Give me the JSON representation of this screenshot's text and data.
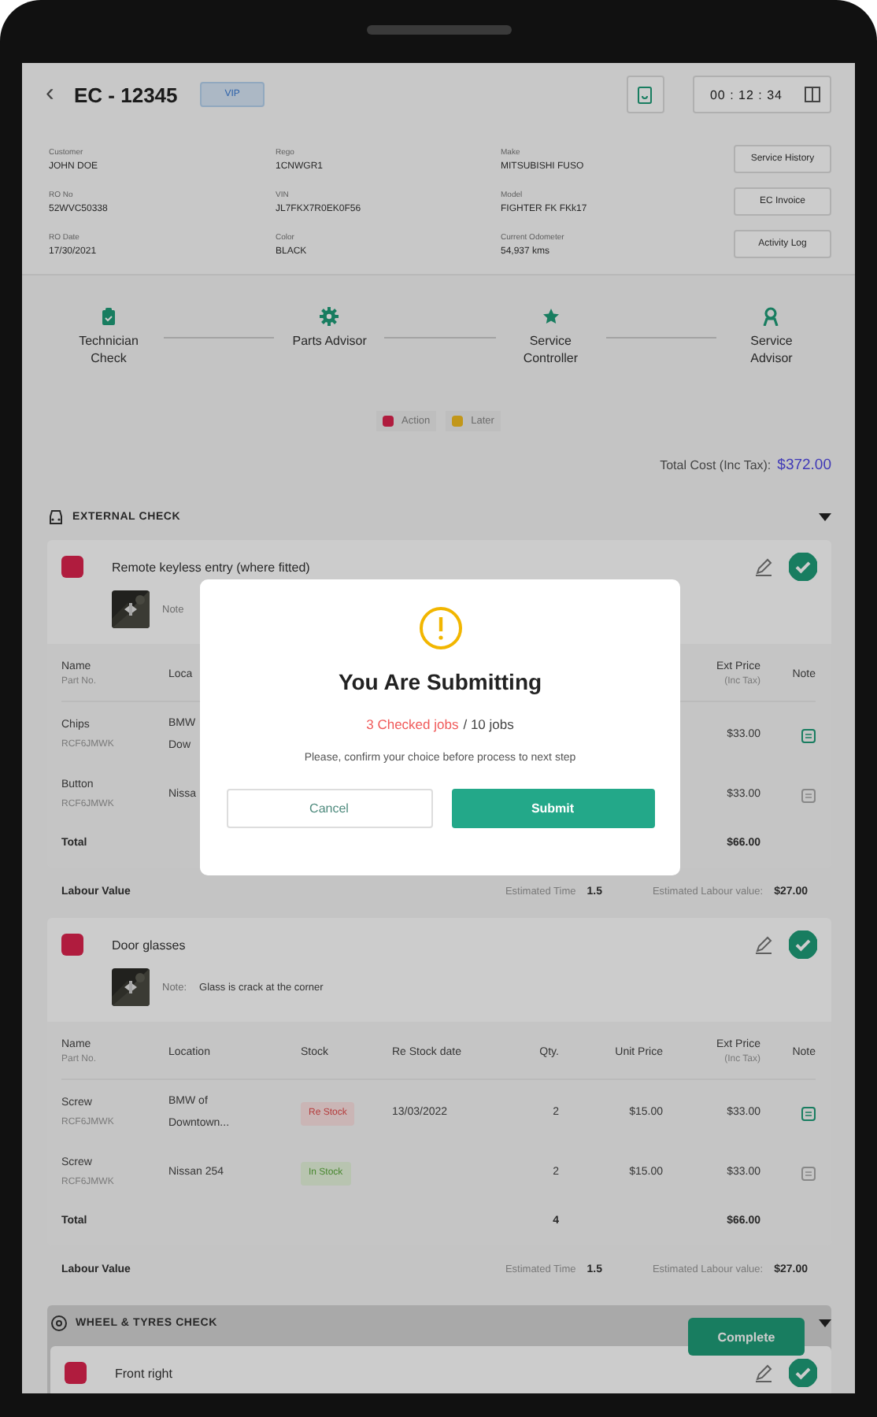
{
  "header": {
    "back": "‹",
    "title": "EC - 12345",
    "badge": "VIP",
    "timer": "00 : 12 : 34"
  },
  "info": [
    {
      "label": "Customer",
      "value": "JOHN DOE"
    },
    {
      "label": "Rego",
      "value": "1CNWGR1"
    },
    {
      "label": "Make",
      "value": "MITSUBISHI FUSO"
    },
    {
      "label": "RO No",
      "value": "52WVC50338"
    },
    {
      "label": "VIN",
      "value": "JL7FKX7R0EK0F56"
    },
    {
      "label": "Model",
      "value": "FIGHTER FK FKk17"
    },
    {
      "label": "RO Date",
      "value": "17/30/2021"
    },
    {
      "label": "Color",
      "value": "BLACK"
    },
    {
      "label": "Current Odometer",
      "value": "54,937 kms"
    }
  ],
  "info_buttons": [
    "Service History",
    "EC Invoice",
    "Activity Log"
  ],
  "steps": [
    {
      "label": "Technician Check"
    },
    {
      "label": "Parts Advisor"
    },
    {
      "label": "Service Controller"
    },
    {
      "label": "Service Advisor"
    }
  ],
  "legend": [
    {
      "label": "Action",
      "color": "#b01c3e"
    },
    {
      "label": "Later",
      "color": "#c2971a"
    }
  ],
  "total": {
    "label": "Total Cost (Inc Tax):",
    "value": "$372.00"
  },
  "sections": [
    {
      "title": "EXTERNAL CHECK",
      "items": [
        {
          "title": "Remote keyless entry (where fitted)",
          "color": "#b01c3e",
          "checked": true,
          "photo": {
            "kind": "picture"
          },
          "note_label": "Note",
          "columns": {
            "name": {
              "label": "Name",
              "sub": "Part No."
            },
            "location": {
              "label": "Loca"
            },
            "ext": {
              "label": "Ext Price",
              "sub": "(Inc Tax)"
            },
            "note": {
              "label": "Note"
            }
          },
          "rows": [
            {
              "name": "Chips",
              "part": "RCF6JMWK",
              "location": [
                "BMW",
                "Dow"
              ],
              "ext": "$33.00",
              "note_on": true
            },
            {
              "name": "Button",
              "part": "RCF6JMWK",
              "location": [
                "Nissa"
              ],
              "ext": "$33.00",
              "note_on": false
            }
          ],
          "total": {
            "label": "Total",
            "ext": "$66.00"
          },
          "labour": {
            "label": "Labour Value",
            "time_label": "Estimated Time",
            "time": "1.5",
            "value_label": "Estimated Labour value:",
            "value": "$27.00"
          }
        },
        {
          "title": "Door glasses",
          "color": "#b01c3e",
          "checked": true,
          "photo": {
            "kind": "picture"
          },
          "note_label": "Note:",
          "note": "Glass is crack at the corner",
          "columns": {
            "name": {
              "label": "Name",
              "sub": "Part No."
            },
            "location": {
              "label": "Location"
            },
            "stock": {
              "label": "Stock"
            },
            "restock": {
              "label": "Re Stock date"
            },
            "qty": {
              "label": "Qty."
            },
            "unit": {
              "label": "Unit Price"
            },
            "ext": {
              "label": "Ext Price",
              "sub": "(Inc Tax)"
            },
            "note": {
              "label": "Note"
            }
          },
          "rows": [
            {
              "name": "Screw",
              "part": "RCF6JMWK",
              "location": [
                "BMW of",
                "Downtown..."
              ],
              "stock": {
                "label": "Re Stock",
                "kind": "restock"
              },
              "restock": "13/03/2022",
              "qty": "2",
              "unit": "$15.00",
              "ext": "$33.00",
              "note_on": true
            },
            {
              "name": "Screw",
              "part": "RCF6JMWK",
              "location": [
                "Nissan 254"
              ],
              "stock": {
                "label": "In Stock",
                "kind": "instock"
              },
              "qty": "2",
              "unit": "$15.00",
              "ext": "$33.00",
              "note_on": false
            }
          ],
          "total": {
            "label": "Total",
            "qty": "4",
            "ext": "$66.00"
          },
          "labour": {
            "label": "Labour Value",
            "time_label": "Estimated Time",
            "time": "1.5",
            "value_label": "Estimated Labour value:",
            "value": "$27.00"
          }
        }
      ]
    },
    {
      "title": "WHEEL & TYRES CHECK",
      "items": [
        {
          "title": "Front right",
          "color": "#b01c3e",
          "checked": true
        }
      ]
    }
  ],
  "complete_button": "Complete",
  "modal": {
    "title": "You Are Submitting",
    "checked_jobs": "3 Checked jobs",
    "all_jobs": "/ 10 jobs",
    "message": "Please, confirm your choice before process to next step",
    "buttons": [
      {
        "label": "Cancel",
        "kind": "secondary"
      },
      {
        "label": "Submit",
        "kind": "primary"
      }
    ]
  }
}
